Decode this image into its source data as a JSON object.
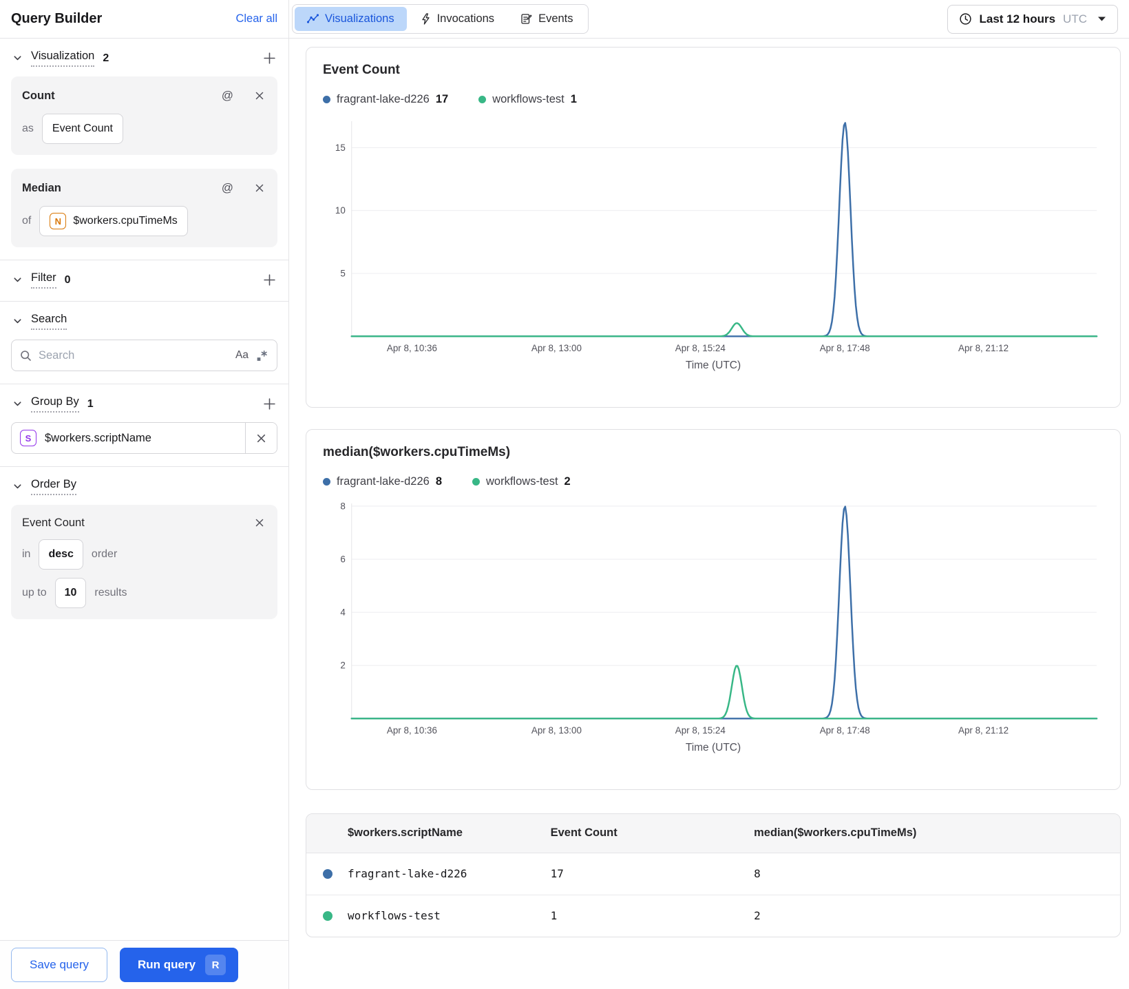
{
  "sidebar": {
    "title": "Query Builder",
    "clear_all": "Clear all",
    "visualization": {
      "label": "Visualization",
      "count": "2",
      "cards": [
        {
          "title": "Count",
          "prefix": "as",
          "value": "Event Count"
        },
        {
          "title": "Median",
          "prefix": "of",
          "badge": "N",
          "value": "$workers.cpuTimeMs"
        }
      ]
    },
    "filter": {
      "label": "Filter",
      "count": "0"
    },
    "search": {
      "label": "Search",
      "placeholder": "Search",
      "match_case_label": "Aa"
    },
    "group_by": {
      "label": "Group By",
      "count": "1",
      "badge": "S",
      "value": "$workers.scriptName"
    },
    "order_by": {
      "label": "Order By",
      "field": "Event Count",
      "in_label": "in",
      "direction": "desc",
      "order_label": "order",
      "up_to_label": "up to",
      "limit": "10",
      "results_label": "results"
    },
    "footer": {
      "save_label": "Save query",
      "run_label": "Run query",
      "run_shortcut": "R"
    }
  },
  "header": {
    "tabs": [
      {
        "label": "Visualizations",
        "active": true
      },
      {
        "label": "Invocations",
        "active": false
      },
      {
        "label": "Events",
        "active": false
      }
    ],
    "time_range": {
      "label": "Last 12 hours",
      "timezone": "UTC"
    }
  },
  "colors": {
    "accent": "#2563eb",
    "series_blue": "#3d6fa8",
    "series_green": "#38b786",
    "badge_orange": "#d97706",
    "badge_purple": "#9333ea",
    "tab_active_bg": "#bcd7fa"
  },
  "chart_data": [
    {
      "type": "line",
      "title": "Event Count",
      "xlabel": "Time (UTC)",
      "ylim": [
        0,
        17.1
      ],
      "yticks": [
        5,
        10,
        15
      ],
      "xticks": [
        "Apr 8, 10:36",
        "Apr 8, 13:00",
        "Apr 8, 15:24",
        "Apr 8, 17:48",
        "Apr 8, 21:12"
      ],
      "xtick_positions": [
        0.081,
        0.275,
        0.468,
        0.662,
        0.848
      ],
      "grid": true,
      "legend_position": "top",
      "legend": [
        {
          "name": "fragrant-lake-d226",
          "value": "17",
          "color": "#3d6fa8"
        },
        {
          "name": "workflows-test",
          "value": "1",
          "color": "#38b786"
        }
      ],
      "series": [
        {
          "name": "fragrant-lake-d226",
          "color": "#3d6fa8",
          "baseline": 0,
          "spikes": [
            {
              "center": 0.662,
              "peak": 17,
              "sigma": 0.0075
            }
          ]
        },
        {
          "name": "workflows-test",
          "color": "#38b786",
          "baseline": 0,
          "spikes": [
            {
              "center": 0.517,
              "peak": 1.05,
              "sigma": 0.0068
            }
          ]
        }
      ]
    },
    {
      "type": "line",
      "title": "median($workers.cpuTimeMs)",
      "xlabel": "Time (UTC)",
      "ylim": [
        0,
        8.1
      ],
      "yticks": [
        2,
        4,
        6,
        8
      ],
      "xticks": [
        "Apr 8, 10:36",
        "Apr 8, 13:00",
        "Apr 8, 15:24",
        "Apr 8, 17:48",
        "Apr 8, 21:12"
      ],
      "xtick_positions": [
        0.081,
        0.275,
        0.468,
        0.662,
        0.848
      ],
      "grid": true,
      "legend_position": "top",
      "legend": [
        {
          "name": "fragrant-lake-d226",
          "value": "8",
          "color": "#3d6fa8"
        },
        {
          "name": "workflows-test",
          "value": "2",
          "color": "#38b786"
        }
      ],
      "series": [
        {
          "name": "fragrant-lake-d226",
          "color": "#3d6fa8",
          "baseline": 0,
          "spikes": [
            {
              "center": 0.662,
              "peak": 8,
              "sigma": 0.0075
            }
          ]
        },
        {
          "name": "workflows-test",
          "color": "#38b786",
          "baseline": 0,
          "spikes": [
            {
              "center": 0.517,
              "peak": 2,
              "sigma": 0.0068
            }
          ]
        }
      ]
    },
    {
      "type": "table",
      "columns": [
        "$workers.scriptName",
        "Event Count",
        "median($workers.cpuTimeMs)"
      ],
      "rows": [
        {
          "color": "#3d6fa8",
          "cells": [
            "fragrant-lake-d226",
            "17",
            "8"
          ]
        },
        {
          "color": "#38b786",
          "cells": [
            "workflows-test",
            "1",
            "2"
          ]
        }
      ]
    }
  ]
}
